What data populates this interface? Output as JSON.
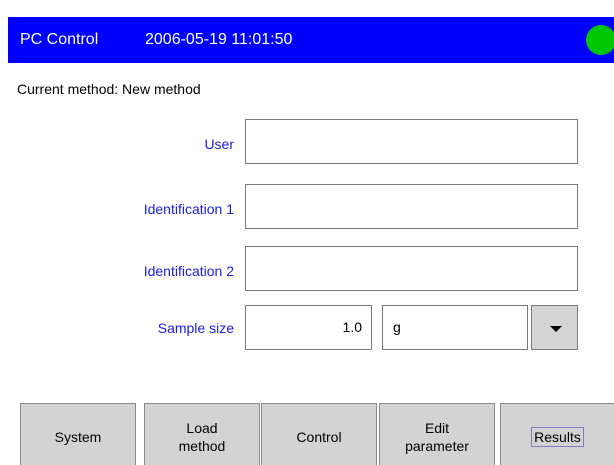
{
  "header": {
    "app_title": "PC Control",
    "datetime": "2006-05-19 11:01:50",
    "status_color": "#00c800",
    "bar_color": "#0000ff"
  },
  "current_method": "Current method: New method",
  "fields": {
    "user_label": "User",
    "user_value": "",
    "id1_label": "Identification 1",
    "id1_value": "",
    "id2_label": "Identification 2",
    "id2_value": "",
    "sample_label": "Sample size",
    "sample_value": "1.0",
    "unit_value": "g",
    "label_color": "#1a1ae6"
  },
  "buttons": {
    "system": "System",
    "load_method": "Load\nmethod",
    "control": "Control",
    "edit_parameter": "Edit\nparameter",
    "results": "Results"
  }
}
